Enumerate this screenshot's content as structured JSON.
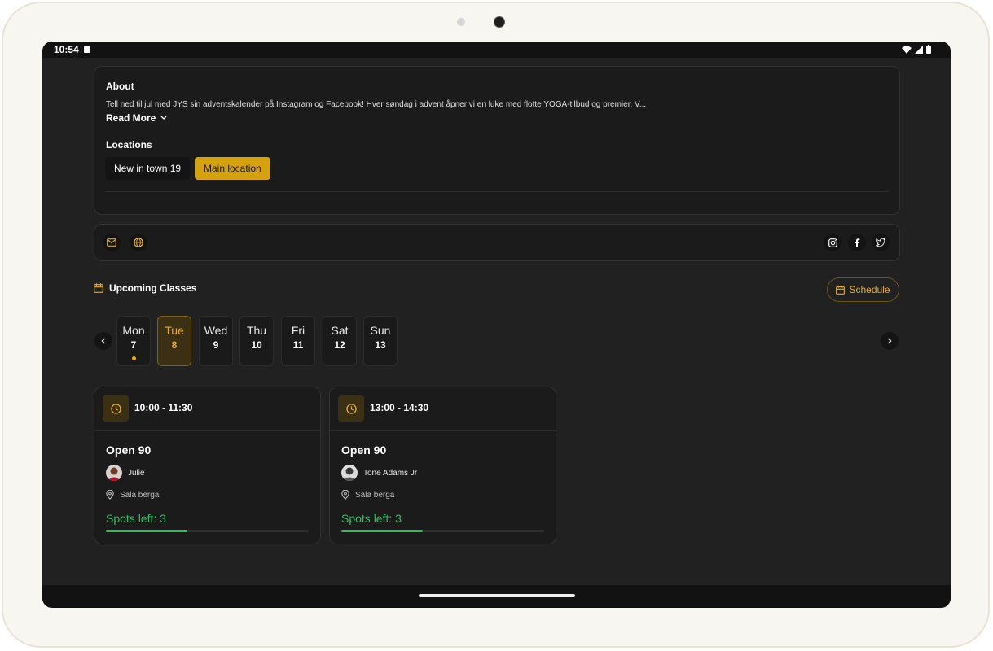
{
  "status_bar": {
    "time": "10:54"
  },
  "about": {
    "heading": "About",
    "text": "Tell ned til jul med JYS sin adventskalender på Instagram og Facebook! Hver søndag i advent åpner vi en luke med flotte YOGA-tilbud og premier. V...",
    "read_more": "Read More"
  },
  "locations": {
    "heading": "Locations",
    "items": [
      {
        "label": "New in town 19",
        "selected": false
      },
      {
        "label": "Main location",
        "selected": true
      }
    ]
  },
  "contact_icons": [
    "mail-icon",
    "globe-icon"
  ],
  "social_icons": [
    "instagram-icon",
    "facebook-icon",
    "twitter-icon"
  ],
  "upcoming": {
    "heading": "Upcoming Classes",
    "schedule_label": "Schedule"
  },
  "days": [
    {
      "name": "Mon",
      "num": "7",
      "has_dot": true,
      "active": false
    },
    {
      "name": "Tue",
      "num": "8",
      "has_dot": false,
      "active": true
    },
    {
      "name": "Wed",
      "num": "9",
      "has_dot": false,
      "active": false
    },
    {
      "name": "Thu",
      "num": "10",
      "has_dot": false,
      "active": false
    },
    {
      "name": "Fri",
      "num": "11",
      "has_dot": false,
      "active": false
    },
    {
      "name": "Sat",
      "num": "12",
      "has_dot": false,
      "active": false
    },
    {
      "name": "Sun",
      "num": "13",
      "has_dot": false,
      "active": false
    }
  ],
  "classes": [
    {
      "time": "10:00 - 11:30",
      "title": "Open 90",
      "instructor": "Julie",
      "location": "Sala berga",
      "spots": "Spots left: 3",
      "fill_fraction": 0.4
    },
    {
      "time": "13:00 - 14:30",
      "title": "Open 90",
      "instructor": "Tone Adams Jr",
      "location": "Sala berga",
      "spots": "Spots left: 3",
      "fill_fraction": 0.4
    }
  ],
  "colors": {
    "accent": "#e5ad1e",
    "chip_selected": "#d4a20d",
    "success": "#2fbf5a",
    "background": "#212121",
    "card": "#1b1b1b"
  }
}
